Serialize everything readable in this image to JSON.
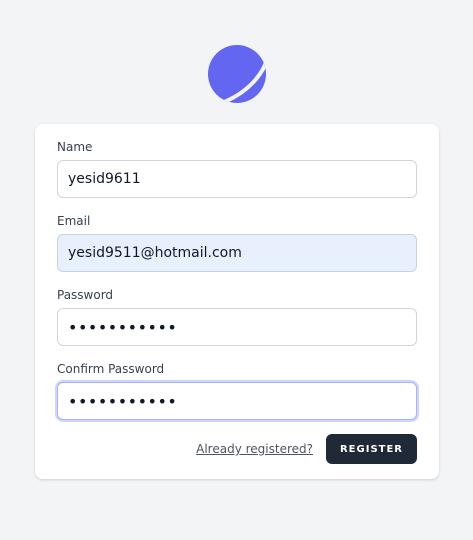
{
  "brand": {
    "logo_icon": "planet-logo-icon",
    "logo_color": "#6366f1"
  },
  "form": {
    "name": {
      "label": "Name",
      "value": "yesid9611"
    },
    "email": {
      "label": "Email",
      "value": "yesid9511@hotmail.com"
    },
    "password": {
      "label": "Password",
      "value": "•••••••••••"
    },
    "confirm_password": {
      "label": "Confirm Password",
      "value": "•••••••••••"
    },
    "login_link": "Already registered?",
    "submit_label": "REGISTER"
  },
  "colors": {
    "page_background": "#f3f4f6",
    "button_background": "#1f2937",
    "autofill_background": "#e8f0fe",
    "focus_ring": "#a5b4fc"
  }
}
